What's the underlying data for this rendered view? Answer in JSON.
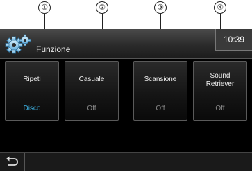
{
  "callouts": [
    "①",
    "②",
    "③",
    "④"
  ],
  "header": {
    "title": "Funzione",
    "clock": "10:39",
    "icon": "gears-icon"
  },
  "functions": [
    {
      "label": "Ripeti",
      "value": "Disco",
      "active": true
    },
    {
      "label": "Casuale",
      "value": "Off",
      "active": false
    },
    {
      "label": "Scansione",
      "value": "Off",
      "active": false
    },
    {
      "label": "Sound\nRetriever",
      "value": "Off",
      "active": false
    }
  ],
  "footer": {
    "back_icon": "back-arrow-icon"
  },
  "colors": {
    "active_value": "#3fb6e8",
    "inactive_value": "#8a8a8a"
  }
}
